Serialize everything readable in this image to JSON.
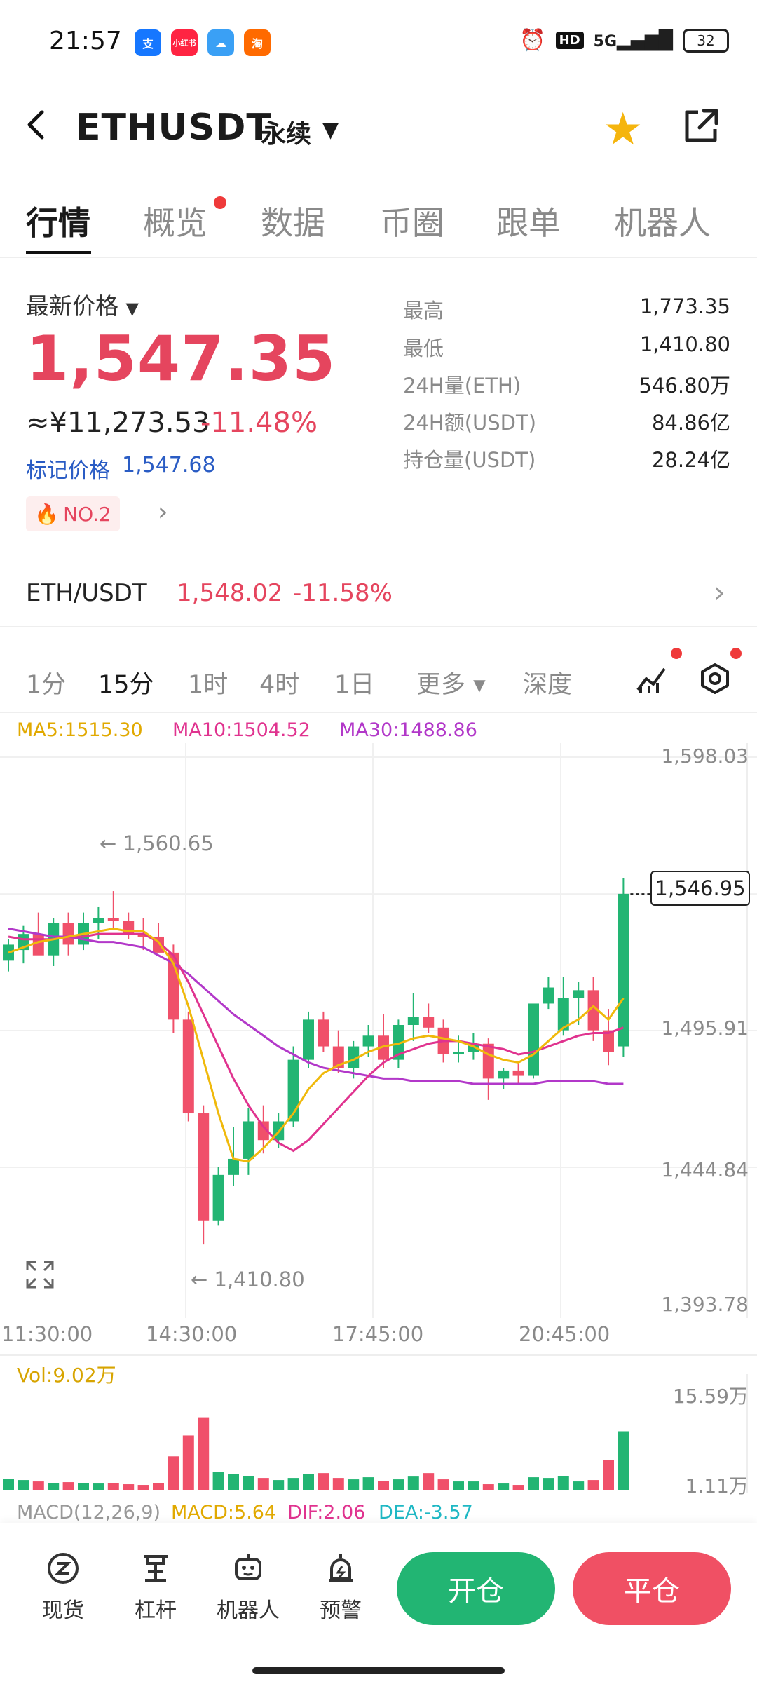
{
  "status_bar": {
    "time": "21:57",
    "app_icons": [
      "alipay",
      "xiaohongshu",
      "weather",
      "taobao"
    ],
    "network": "5G",
    "battery": "32"
  },
  "header": {
    "symbol": "ETHUSDT",
    "contract_type": "永续"
  },
  "tabs": [
    {
      "label": "行情",
      "active": true
    },
    {
      "label": "概览",
      "active": false,
      "dot": true
    },
    {
      "label": "数据",
      "active": false
    },
    {
      "label": "币圈",
      "active": false
    },
    {
      "label": "跟单",
      "active": false
    },
    {
      "label": "机器人",
      "active": false
    }
  ],
  "price_panel": {
    "last_price_label": "最新价格",
    "last_price": "1,547.35",
    "cny_price": "≈¥11,273.53",
    "change_pct": "-11.48%",
    "mark_price_label": "标记价格",
    "mark_price": "1,547.68",
    "rank_badge": "NO.2"
  },
  "stats": [
    {
      "label": "最高",
      "value": "1,773.35"
    },
    {
      "label": "最低",
      "value": "1,410.80"
    },
    {
      "label": "24H量(ETH)",
      "value": "546.80万"
    },
    {
      "label": "24H额(USDT)",
      "value": "84.86亿"
    },
    {
      "label": "持仓量(USDT)",
      "value": "28.24亿"
    }
  ],
  "spot": {
    "pair": "ETH/USDT",
    "price": "1,548.02",
    "change": "-11.58%"
  },
  "intervals": [
    {
      "label": "1分",
      "active": false
    },
    {
      "label": "15分",
      "active": true
    },
    {
      "label": "1时",
      "active": false
    },
    {
      "label": "4时",
      "active": false
    },
    {
      "label": "1日",
      "active": false
    },
    {
      "label": "更多 ▾",
      "active": false
    },
    {
      "label": "深度",
      "active": false
    }
  ],
  "ma_legend": {
    "ma5": "MA5:1515.30",
    "ma10": "MA10:1504.52",
    "ma30": "MA30:1488.86"
  },
  "colors": {
    "up": "#22b573",
    "down": "#f0506a",
    "ma5": "#f0b90b",
    "ma10": "#e0338f",
    "ma30": "#b238c9"
  },
  "chart_data": {
    "type": "candlestick",
    "y_ticks": [
      "1,598.03",
      "1,495.91",
      "1,444.84",
      "1,393.78"
    ],
    "ylim": [
      1393.78,
      1598.03
    ],
    "x_ticks": [
      "11:30:00",
      "14:30:00",
      "17:45:00",
      "20:45:00"
    ],
    "current_price_label": "1,546.95",
    "high_annotation": "← 1,560.65",
    "low_annotation": "← 1,410.80",
    "candles": [
      {
        "o": 1522,
        "h": 1530,
        "l": 1518,
        "c": 1528
      },
      {
        "o": 1526,
        "h": 1535,
        "l": 1521,
        "c": 1532
      },
      {
        "o": 1532,
        "h": 1540,
        "l": 1527,
        "c": 1524
      },
      {
        "o": 1524,
        "h": 1538,
        "l": 1520,
        "c": 1536
      },
      {
        "o": 1536,
        "h": 1540,
        "l": 1524,
        "c": 1528
      },
      {
        "o": 1528,
        "h": 1540,
        "l": 1526,
        "c": 1536
      },
      {
        "o": 1536,
        "h": 1542,
        "l": 1530,
        "c": 1538
      },
      {
        "o": 1538,
        "h": 1548,
        "l": 1534,
        "c": 1537
      },
      {
        "o": 1537,
        "h": 1540,
        "l": 1530,
        "c": 1532
      },
      {
        "o": 1532,
        "h": 1538,
        "l": 1526,
        "c": 1531
      },
      {
        "o": 1531,
        "h": 1536,
        "l": 1526,
        "c": 1525
      },
      {
        "o": 1525,
        "h": 1528,
        "l": 1495,
        "c": 1500
      },
      {
        "o": 1500,
        "h": 1503,
        "l": 1462,
        "c": 1465
      },
      {
        "o": 1465,
        "h": 1468,
        "l": 1416,
        "c": 1425
      },
      {
        "o": 1425,
        "h": 1445,
        "l": 1423,
        "c": 1442
      },
      {
        "o": 1442,
        "h": 1460,
        "l": 1438,
        "c": 1448
      },
      {
        "o": 1448,
        "h": 1467,
        "l": 1442,
        "c": 1462
      },
      {
        "o": 1462,
        "h": 1468,
        "l": 1450,
        "c": 1455
      },
      {
        "o": 1455,
        "h": 1465,
        "l": 1452,
        "c": 1462
      },
      {
        "o": 1462,
        "h": 1490,
        "l": 1460,
        "c": 1485
      },
      {
        "o": 1485,
        "h": 1503,
        "l": 1482,
        "c": 1500
      },
      {
        "o": 1500,
        "h": 1503,
        "l": 1488,
        "c": 1490
      },
      {
        "o": 1490,
        "h": 1496,
        "l": 1480,
        "c": 1482
      },
      {
        "o": 1482,
        "h": 1492,
        "l": 1478,
        "c": 1490
      },
      {
        "o": 1490,
        "h": 1498,
        "l": 1486,
        "c": 1494
      },
      {
        "o": 1494,
        "h": 1502,
        "l": 1482,
        "c": 1485
      },
      {
        "o": 1485,
        "h": 1500,
        "l": 1482,
        "c": 1498
      },
      {
        "o": 1498,
        "h": 1510,
        "l": 1492,
        "c": 1501
      },
      {
        "o": 1501,
        "h": 1506,
        "l": 1495,
        "c": 1497
      },
      {
        "o": 1497,
        "h": 1500,
        "l": 1484,
        "c": 1487
      },
      {
        "o": 1487,
        "h": 1494,
        "l": 1484,
        "c": 1488
      },
      {
        "o": 1488,
        "h": 1495,
        "l": 1485,
        "c": 1491
      },
      {
        "o": 1491,
        "h": 1493,
        "l": 1470,
        "c": 1478
      },
      {
        "o": 1478,
        "h": 1482,
        "l": 1474,
        "c": 1481
      },
      {
        "o": 1481,
        "h": 1484,
        "l": 1476,
        "c": 1479
      },
      {
        "o": 1479,
        "h": 1500,
        "l": 1478,
        "c": 1506
      },
      {
        "o": 1506,
        "h": 1516,
        "l": 1504,
        "c": 1512
      },
      {
        "o": 1496,
        "h": 1516,
        "l": 1494,
        "c": 1508
      },
      {
        "o": 1508,
        "h": 1514,
        "l": 1498,
        "c": 1511
      },
      {
        "o": 1511,
        "h": 1516,
        "l": 1492,
        "c": 1496
      },
      {
        "o": 1496,
        "h": 1504,
        "l": 1483,
        "c": 1488
      },
      {
        "o": 1490,
        "h": 1553,
        "l": 1486,
        "c": 1547
      }
    ],
    "ma5": [
      1525,
      1527,
      1529,
      1530,
      1531,
      1532,
      1533,
      1534,
      1533,
      1533,
      1529,
      1521,
      1505,
      1485,
      1465,
      1448,
      1447,
      1452,
      1458,
      1465,
      1474,
      1480,
      1483,
      1485,
      1488,
      1490,
      1491,
      1493,
      1494,
      1493,
      1492,
      1490,
      1487,
      1485,
      1484,
      1487,
      1492,
      1497,
      1500,
      1505,
      1500,
      1508
    ],
    "ma10": [
      1531,
      1530,
      1530,
      1530,
      1531,
      1531,
      1532,
      1532,
      1532,
      1532,
      1529,
      1524,
      1514,
      1502,
      1490,
      1478,
      1468,
      1460,
      1454,
      1451,
      1455,
      1461,
      1467,
      1473,
      1479,
      1484,
      1487,
      1489,
      1491,
      1492,
      1492,
      1491,
      1490,
      1489,
      1487,
      1488,
      1490,
      1492,
      1494,
      1495,
      1495,
      1497
    ],
    "ma30": [
      1534,
      1533,
      1532,
      1531,
      1531,
      1530,
      1529,
      1529,
      1528,
      1527,
      1524,
      1521,
      1517,
      1512,
      1507,
      1502,
      1498,
      1494,
      1490,
      1487,
      1484,
      1482,
      1481,
      1480,
      1479,
      1478,
      1478,
      1477,
      1477,
      1477,
      1477,
      1476,
      1476,
      1476,
      1476,
      1476,
      1477,
      1477,
      1477,
      1477,
      1476,
      1476
    ]
  },
  "volume": {
    "label": "Vol:9.02万",
    "y_top": "15.59万",
    "y_bottom": "1.11万",
    "values": [
      1.6,
      1.4,
      1.2,
      1.0,
      1.1,
      1.0,
      0.9,
      1.0,
      0.8,
      0.7,
      1.0,
      4.8,
      7.8,
      10.4,
      2.6,
      2.3,
      2.0,
      1.7,
      1.4,
      1.7,
      2.3,
      2.4,
      1.7,
      1.5,
      1.8,
      1.3,
      1.5,
      1.9,
      2.4,
      1.5,
      1.2,
      1.2,
      0.8,
      0.9,
      0.7,
      1.8,
      1.7,
      2.0,
      1.2,
      1.4,
      4.3,
      8.4
    ]
  },
  "macd": {
    "params": "MACD(12,26,9)",
    "macd": "MACD:5.64",
    "dif": "DIF:2.06",
    "dea": "DEA:-3.57"
  },
  "bottom_nav": [
    {
      "label": "现货",
      "icon": "spot-icon"
    },
    {
      "label": "杠杆",
      "icon": "leverage-icon"
    },
    {
      "label": "机器人",
      "icon": "robot-icon"
    },
    {
      "label": "预警",
      "icon": "alarm-icon"
    }
  ],
  "actions": {
    "open": "开仓",
    "close": "平仓"
  }
}
